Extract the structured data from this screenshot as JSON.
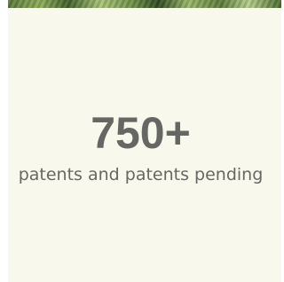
{
  "stat": {
    "value": "750+",
    "label": "patents and patents pending"
  },
  "colors": {
    "card_background": "#f8f9ec",
    "text": "#666763"
  }
}
